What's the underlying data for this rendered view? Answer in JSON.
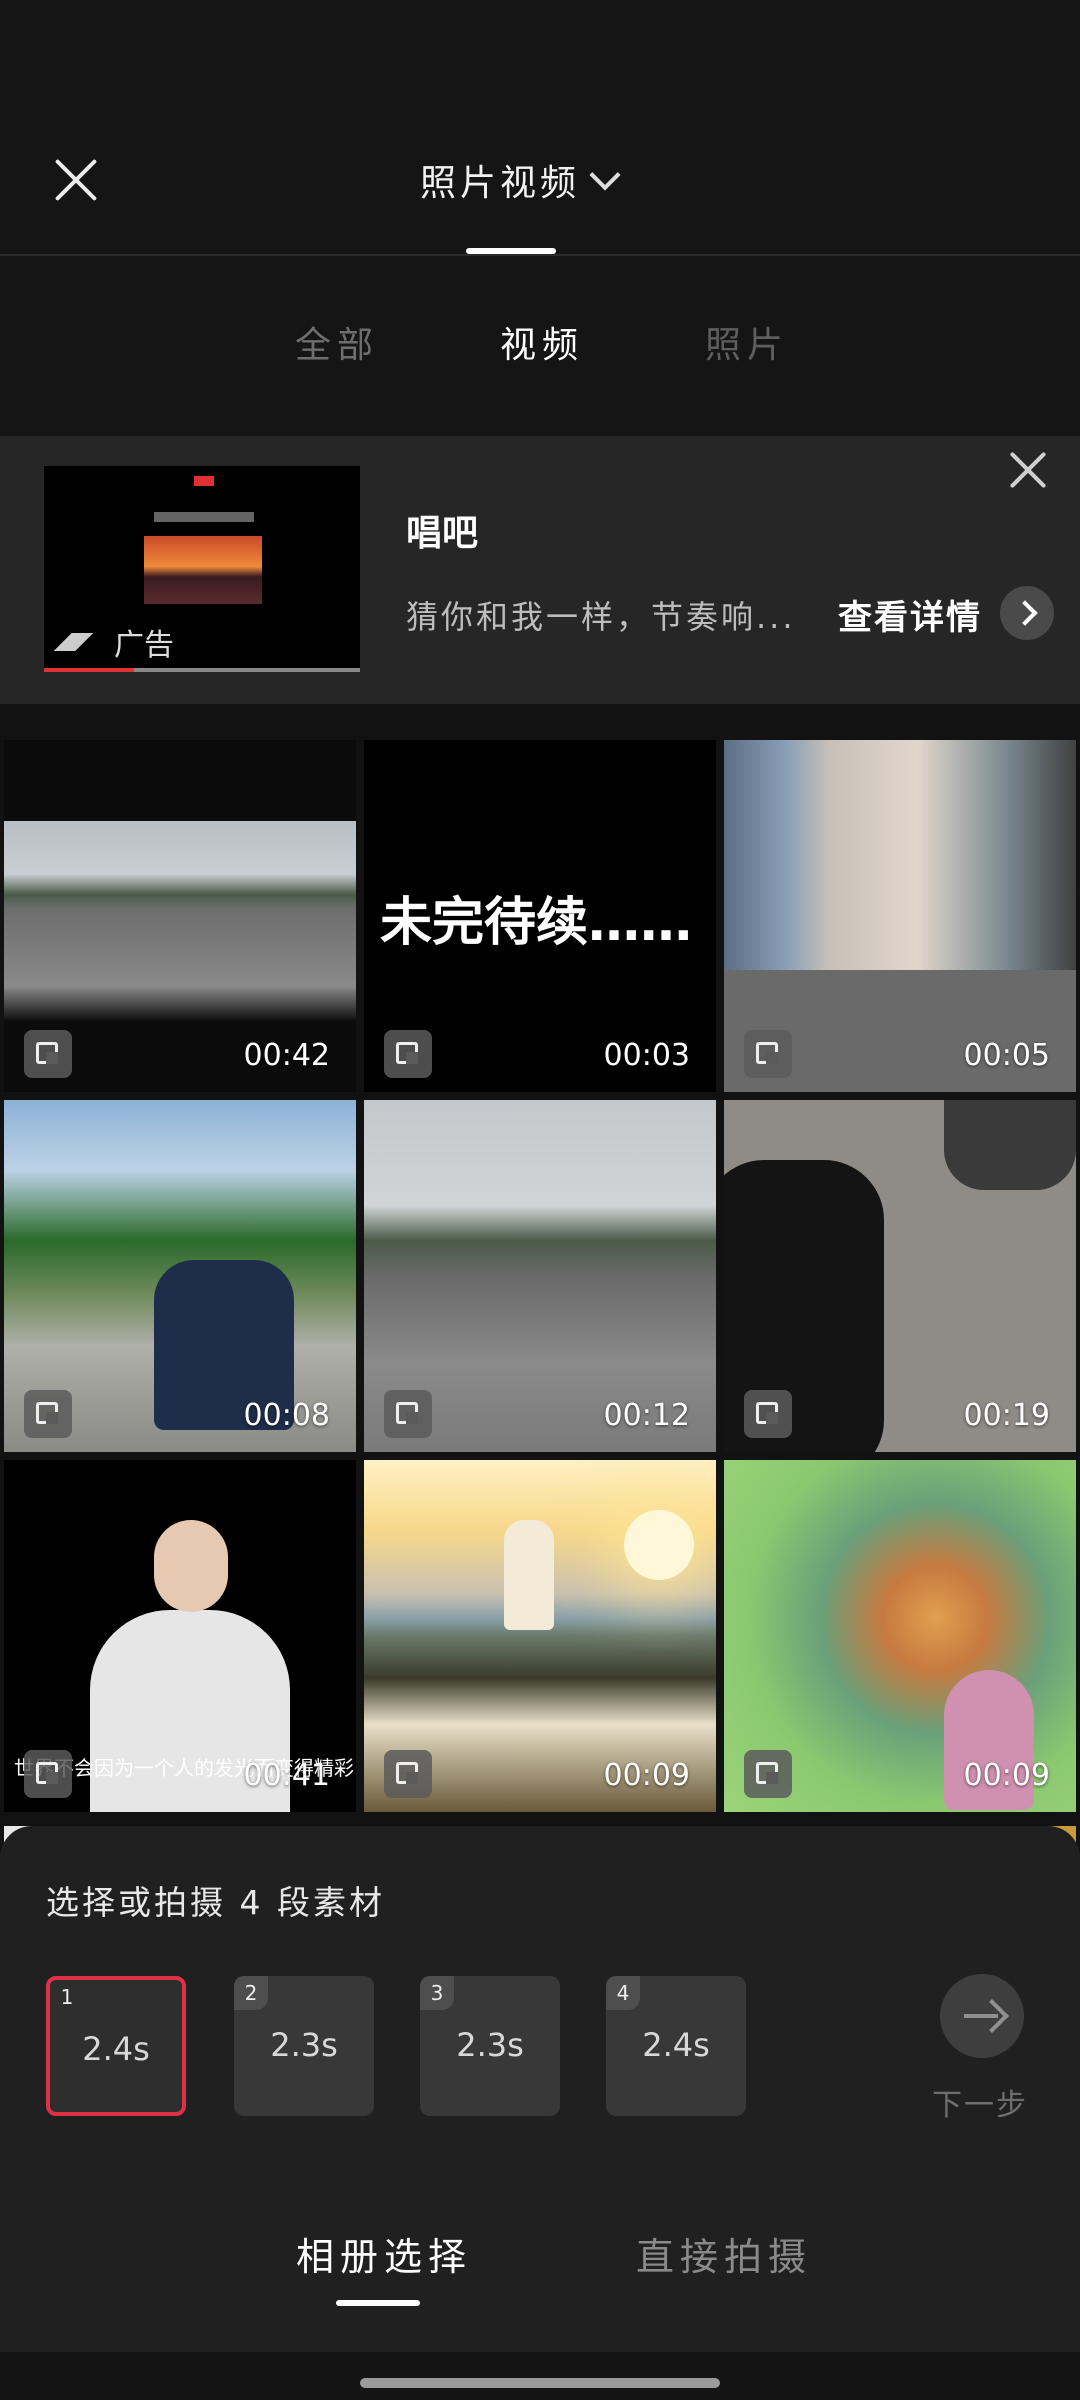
{
  "header": {
    "album_label": "照片视频",
    "close_icon": "close-icon",
    "chevron_icon": "chevron-down-icon"
  },
  "filter_tabs": [
    {
      "label": "全部",
      "selected": false
    },
    {
      "label": "视频",
      "selected": true
    },
    {
      "label": "照片",
      "selected": false
    }
  ],
  "ad": {
    "badge": "广告",
    "title": "唱吧",
    "description": "猜你和我一样，节奏响...",
    "cta": "查看详情"
  },
  "media": [
    {
      "type": "video",
      "duration": "00:42"
    },
    {
      "type": "video",
      "duration": "00:03",
      "caption": "未完待续……"
    },
    {
      "type": "video",
      "duration": "00:05"
    },
    {
      "type": "video",
      "duration": "00:08"
    },
    {
      "type": "video",
      "duration": "00:12"
    },
    {
      "type": "video",
      "duration": "00:19"
    },
    {
      "type": "video",
      "duration": "00:41",
      "subtitle": "世界不会因为一个人的发光而变得精彩"
    },
    {
      "type": "video",
      "duration": "00:09"
    },
    {
      "type": "video",
      "duration": "00:09"
    }
  ],
  "selection": {
    "title": "选择或拍摄 4 段素材",
    "slots": [
      {
        "index": "1",
        "length": "2.4s",
        "active": true
      },
      {
        "index": "2",
        "length": "2.3s",
        "active": false
      },
      {
        "index": "3",
        "length": "2.3s",
        "active": false
      },
      {
        "index": "4",
        "length": "2.4s",
        "active": false
      }
    ],
    "next_label": "下一步"
  },
  "mode_tabs": [
    {
      "label": "相册选择",
      "selected": true
    },
    {
      "label": "直接拍摄",
      "selected": false
    }
  ],
  "colors": {
    "background": "#121212",
    "accent_active_slot": "#e03048",
    "sheet": "#202020"
  }
}
